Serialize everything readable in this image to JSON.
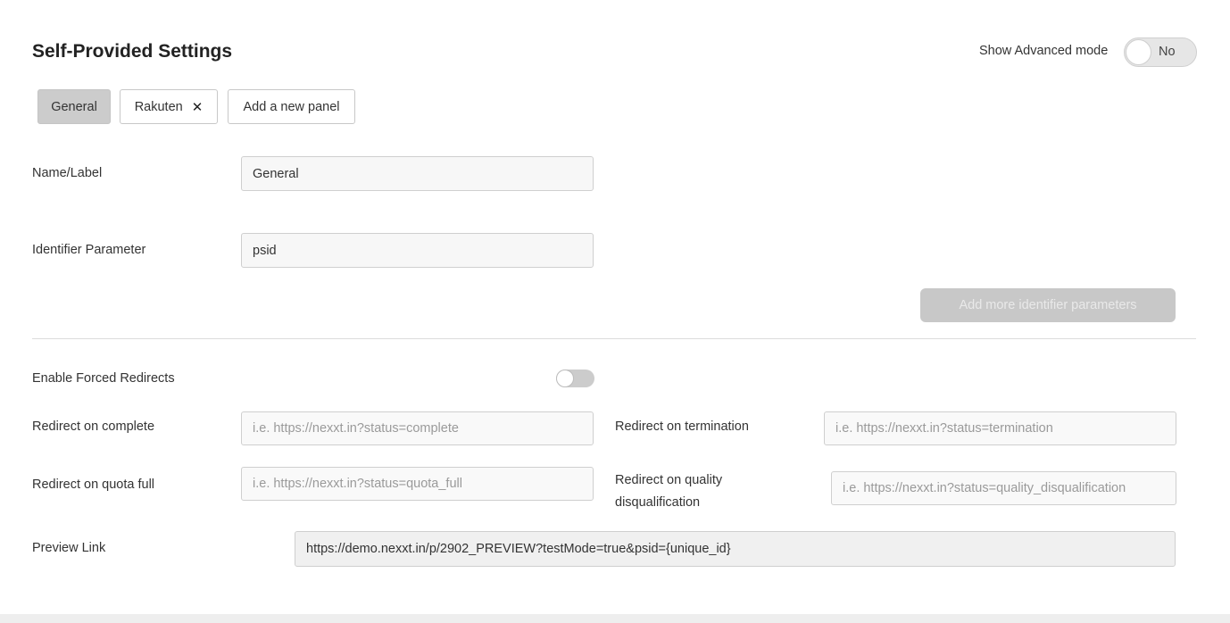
{
  "header": {
    "title": "Self-Provided Settings",
    "advanced_mode_label": "Show Advanced mode",
    "advanced_mode_value": "No"
  },
  "tabs": [
    {
      "label": "General",
      "active": true
    },
    {
      "label": "Rakuten",
      "close": "✕"
    },
    {
      "label": "Add a new panel"
    }
  ],
  "form": {
    "name_label": "Name/Label",
    "name_value": "General",
    "identifier_label": "Identifier Parameter",
    "identifier_value": "psid",
    "add_more_button": "Add more identifier parameters",
    "forced_redirects_label": "Enable Forced Redirects",
    "forced_redirects_enabled": false,
    "redirect_complete_label": "Redirect on complete",
    "redirect_complete_placeholder": "i.e. https://nexxt.in?status=complete",
    "redirect_termination_label": "Redirect on termination",
    "redirect_termination_placeholder": "i.e. https://nexxt.in?status=termination",
    "redirect_quota_label": "Redirect on quota full",
    "redirect_quota_placeholder": "i.e. https://nexxt.in?status=quota_full",
    "redirect_quality_label_line1": "Redirect on quality",
    "redirect_quality_label_line2": "disqualification",
    "redirect_quality_placeholder": "i.e. https://nexxt.in?status=quality_disqualification",
    "preview_label": "Preview Link",
    "preview_value": "https://demo.nexxt.in/p/2902_PREVIEW?testMode=true&psid={unique_id}"
  }
}
